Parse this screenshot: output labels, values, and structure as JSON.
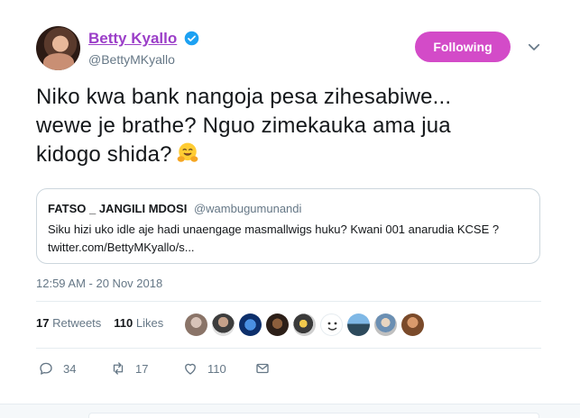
{
  "tweet": {
    "author_name": "Betty Kyallo",
    "author_handle": "@BettyMKyallo",
    "verified_icon": "verified-badge-icon",
    "follow_label": "Following",
    "text_lines": [
      "Niko kwa bank nangoja pesa zihesabiwe...",
      "wewe je brathe? Nguo zimekauka ama jua",
      "kidogo shida?"
    ],
    "emoji": "hugging-face-icon",
    "timestamp": "12:59 AM - 20 Nov 2018"
  },
  "quote": {
    "name": "FATSO _ JANGILI MDOSI",
    "handle": "@wambugumunandi",
    "body_lines": [
      "Siku hizi uko idle aje hadi unaengage masmallwigs huku? Kwani 001 anarudia KCSE ?",
      "twitter.com/BettyMKyallo/s..."
    ]
  },
  "stats": {
    "retweets_count": "17",
    "retweets_label": "Retweets",
    "likes_count": "110",
    "likes_label": "Likes",
    "liker_count_shown": 9
  },
  "actions": {
    "reply_count": "34",
    "retweet_count": "17",
    "like_count": "110"
  },
  "colors": {
    "accent": "#d34bc8",
    "name": "#9b3ec8",
    "verified": "#1da1f2",
    "muted": "#657786"
  }
}
